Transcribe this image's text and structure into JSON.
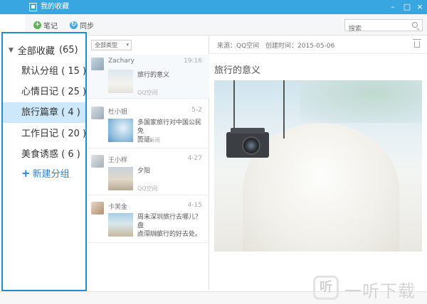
{
  "window": {
    "title": "我的收藏",
    "controls": [
      "–",
      "□",
      "×"
    ]
  },
  "toolbar": {
    "note_label": "笔记",
    "sync_label": "同步",
    "search_placeholder": "搜索"
  },
  "sidebar": {
    "root_label": "全部收藏",
    "root_count": "(65)",
    "items": [
      {
        "label": "默认分组",
        "count": "( 15 )"
      },
      {
        "label": "心情日记",
        "count": "( 25 )"
      },
      {
        "label": "旅行篇章",
        "count": "( 4 )"
      },
      {
        "label": "工作日记",
        "count": "( 20 )"
      },
      {
        "label": "美食诱惑",
        "count": "( 6 )"
      }
    ],
    "new_group_label": "新建分组"
  },
  "list": {
    "filter_label": "全部类型",
    "items": [
      {
        "author": "Zachary",
        "date": "19:16",
        "lines": [
          "旅行的意义"
        ],
        "source": "QQ空间"
      },
      {
        "author": "杜小姐",
        "date": "5-2",
        "lines": [
          "多国家旅行对中国公民免",
          "签证。"
        ],
        "source": "腾讯新闻"
      },
      {
        "author": "王小样",
        "date": "4-27",
        "lines": [
          "夕阳"
        ],
        "source": "QQ空间"
      },
      {
        "author": "卡芙金",
        "date": "4-15",
        "lines": [
          "周末深圳旅行去哪儿？盘",
          "点深圳旅行的好去处。"
        ],
        "source": "腾讯新闻"
      }
    ]
  },
  "detail": {
    "source": "来源：QQ空间",
    "created": "创建时间：2015-05-06",
    "title": "旅行的意义"
  },
  "watermark": {
    "icon": "听",
    "text": "一听下载"
  },
  "colors": {
    "titlebar": "#38a6e0",
    "sidebar_border": "#1f8fd0",
    "active_item": "#cde8fb",
    "accent_link": "#2386d8"
  }
}
